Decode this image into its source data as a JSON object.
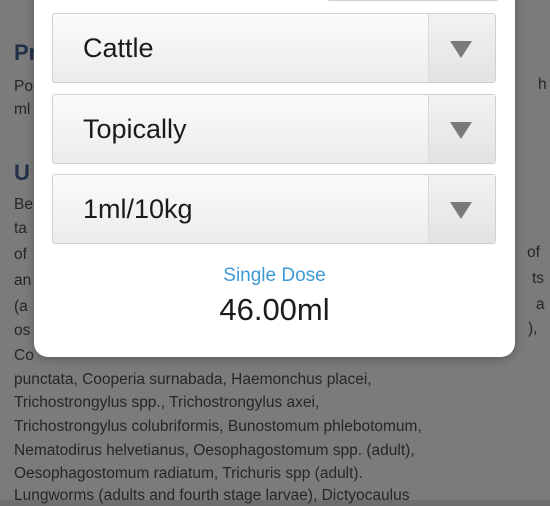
{
  "background": {
    "heading_1": "Pr",
    "line_p1": "Po",
    "line_p2": "ml",
    "right_frag_1": "h",
    "heading_2": "U",
    "lines": [
      "Be",
      "ta",
      "of",
      "an",
      "(a",
      "os",
      "Co",
      "punctata, Cooperia surnabada, Haemonchus placei,",
      "Trichostrongylus spp., Trichostrongylus axei,",
      "Trichostrongylus colubriformis, Bunostomum phlebotomum,",
      "Nematodirus helvetianus, Oesophagostomum spp. (adult),",
      "Oesophagostomum radiatum, Trichuris spp (adult).",
      "Lungworms (adults and fourth stage larvae), Dictyocaulus"
    ],
    "right_frags": [
      "of",
      "ts",
      "a",
      "),"
    ]
  },
  "dialog": {
    "species_select": {
      "value": "Cattle"
    },
    "route_select": {
      "value": "Topically"
    },
    "dose_rate_select": {
      "value": "1ml/10kg"
    },
    "result": {
      "label": "Single Dose",
      "value": "46.00ml"
    }
  },
  "colors": {
    "accent": "#3d9ad6",
    "overlay": "#6e6e6e",
    "dialog_bg": "#ffffff"
  },
  "icons": {
    "select_arrow": "triangle-down"
  }
}
